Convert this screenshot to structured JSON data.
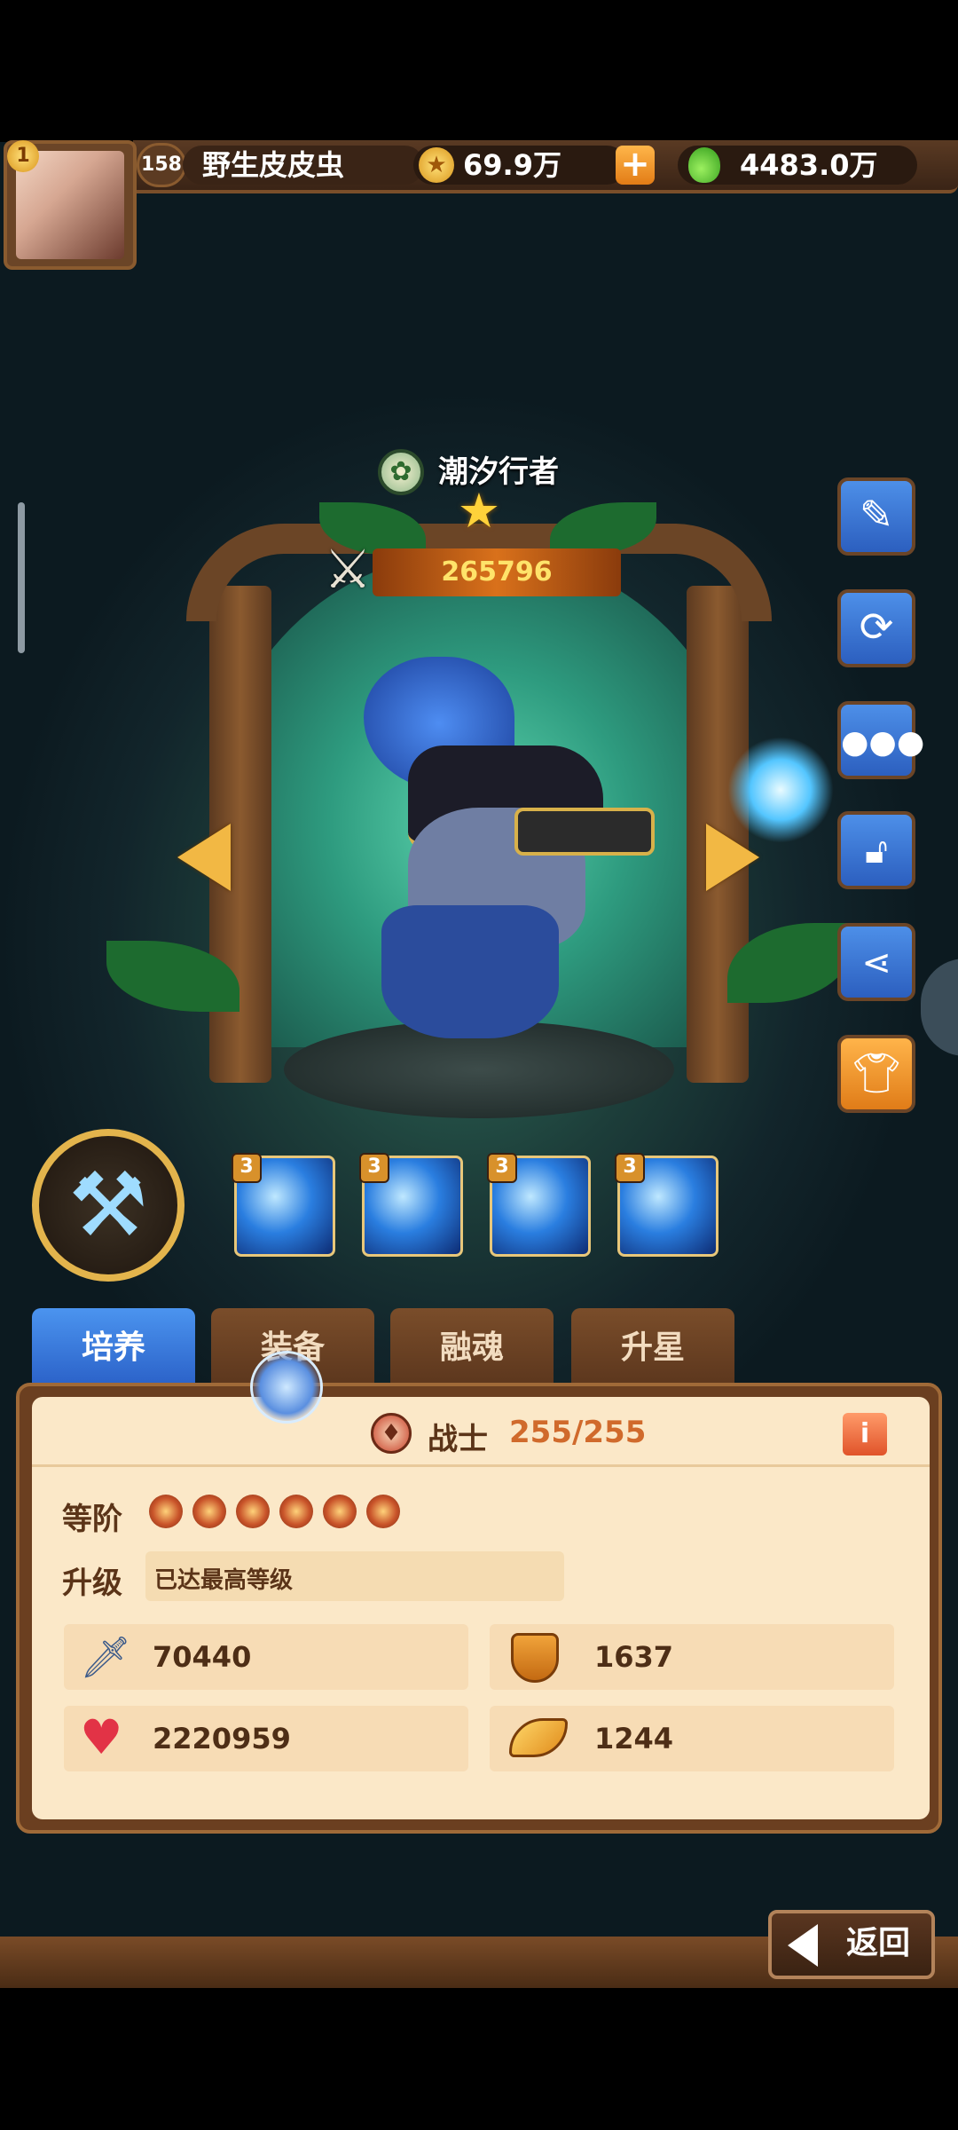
{
  "player": {
    "level": "158",
    "vip": "1",
    "name": "野生皮皮虫"
  },
  "currency": {
    "gold": "69.9万",
    "potion": "4483.0万",
    "add_symbol": "+"
  },
  "hero": {
    "name": "潮汐行者",
    "power": "265796",
    "stars_above": "★"
  },
  "skills": [
    {
      "level": "3"
    },
    {
      "level": "3"
    },
    {
      "level": "3"
    },
    {
      "level": "3"
    }
  ],
  "tabs": [
    {
      "label": "培养",
      "active": true
    },
    {
      "label": "装备",
      "active": false
    },
    {
      "label": "融魂",
      "active": false
    },
    {
      "label": "升星",
      "active": false
    }
  ],
  "panel": {
    "class_name": "战士",
    "class_level": "255/255",
    "rank_label": "等阶",
    "rank_stars": 6,
    "upgrade_label": "升级",
    "upgrade_status": "已达最高等级",
    "stats": {
      "attack": "70440",
      "defense": "1637",
      "hp": "2220959",
      "speed": "1244"
    }
  },
  "side_buttons": [
    "pencil-icon",
    "refresh-icon",
    "chat-icon",
    "unlock-icon",
    "share-icon",
    "outfit-icon"
  ],
  "back_label": "返回"
}
